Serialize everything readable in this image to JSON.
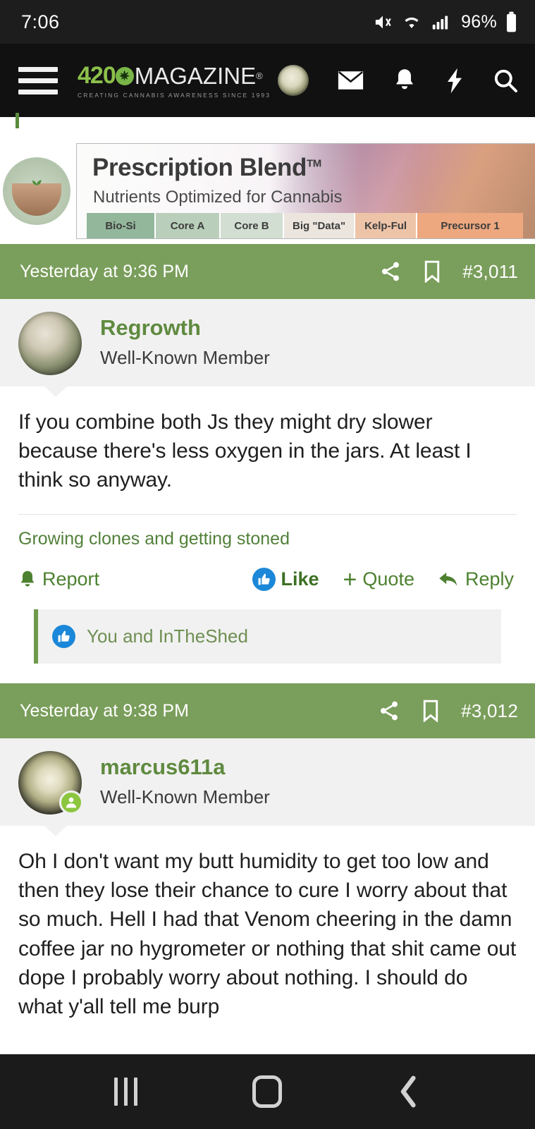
{
  "status_bar": {
    "time": "7:06",
    "battery_percent": "96%",
    "icons": [
      "mute-icon",
      "wifi-icon",
      "signal-icon",
      "battery-icon"
    ]
  },
  "app_header": {
    "menu_icon": "hamburger-menu-icon",
    "logo_number": "420",
    "logo_word": "MAGAZINE",
    "logo_registered": "®",
    "logo_tagline": "CREATING CANNABIS AWARENESS SINCE 1993",
    "icons": [
      "user-avatar",
      "inbox-icon",
      "alerts-icon",
      "whats-new-icon",
      "search-icon"
    ]
  },
  "ad": {
    "title": "Prescription Blend",
    "tm": "TM",
    "subtitle": "Nutrients Optimized for Cannabis",
    "tabs": [
      "Bio-Si",
      "Core A",
      "Core B",
      "Big \"Data\"",
      "Kelp-Ful",
      "Precursor 1"
    ]
  },
  "posts": [
    {
      "date": "Yesterday at 9:36 PM",
      "number": "#3,011",
      "username": "Regrowth",
      "user_title": "Well-Known Member",
      "online": false,
      "body": "If you combine both Js they might dry slower because there's less oxygen in the jars. At least I think so anyway.",
      "signature": "Growing clones and getting stoned",
      "actions": {
        "report": "Report",
        "like": "Like",
        "quote": "Quote",
        "reply": "Reply"
      },
      "likes_text": "You and InTheShed"
    },
    {
      "date": "Yesterday at 9:38 PM",
      "number": "#3,012",
      "username": "marcus611a",
      "user_title": "Well-Known Member",
      "online": true,
      "body": "Oh I don't want my butt humidity to get too low and then they lose their chance to cure I worry about that so much. Hell I had that Venom cheering in the damn coffee jar no hygrometer or nothing that shit came out dope I probably worry about nothing. I should do what y'all tell me burp"
    }
  ],
  "nav_bar": {
    "recents_label": "recents-button",
    "home_label": "home-button",
    "back_label": "back-button"
  },
  "colors": {
    "brand_green": "#7a9e5b",
    "link_green": "#5f8a3f",
    "header_black": "#111111",
    "like_blue": "#1b87d8"
  }
}
